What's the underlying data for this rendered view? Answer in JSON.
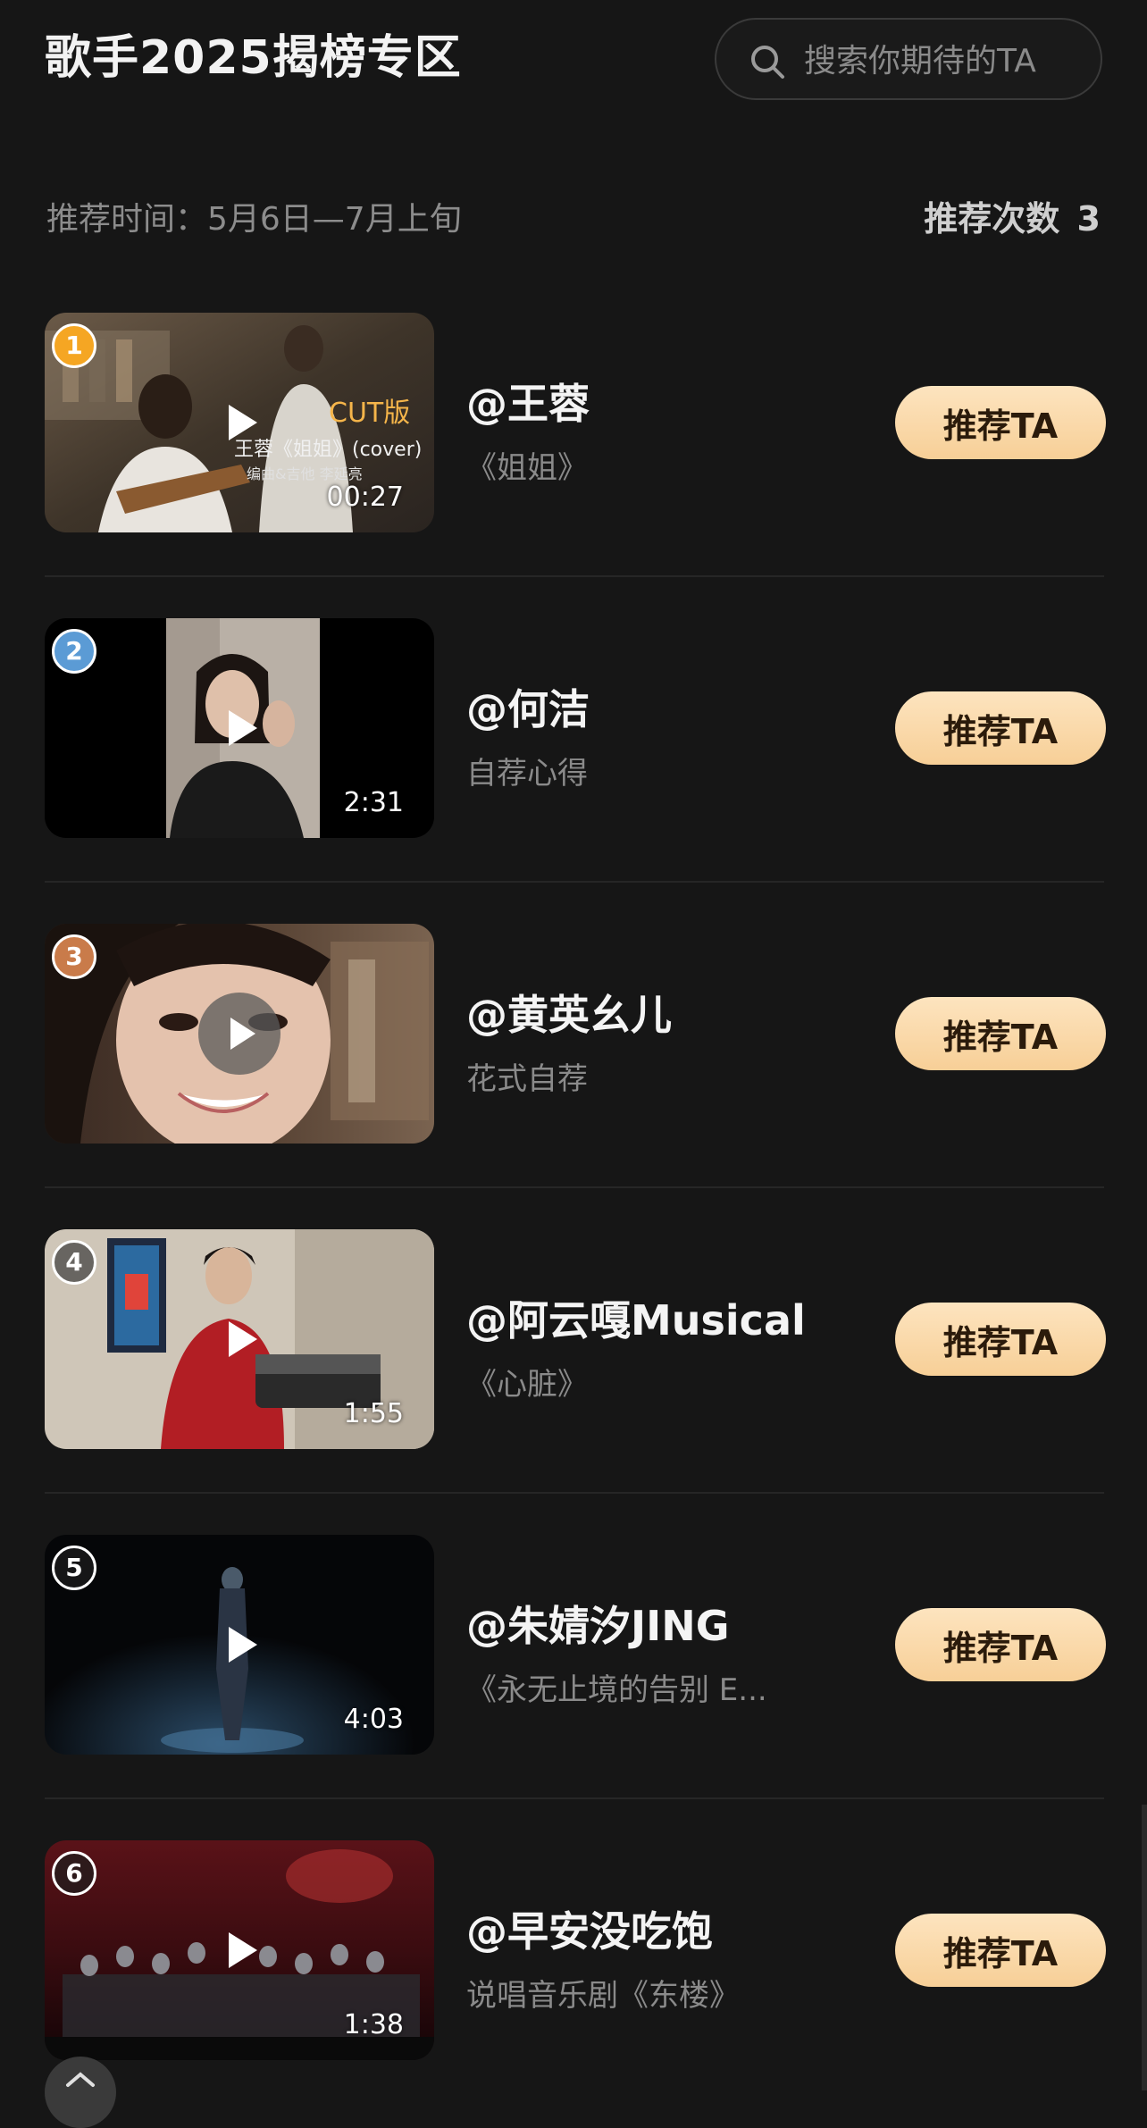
{
  "header": {
    "title": "歌手2025揭榜专区",
    "search_placeholder": "搜索你期待的TA"
  },
  "info": {
    "time_text": "推荐时间：5月6日—7月上旬",
    "count_label": "推荐次数",
    "count_value": "3"
  },
  "button_label": "推荐TA",
  "items": [
    {
      "rank": "1",
      "name": "@王蓉",
      "sub": "《姐姐》",
      "duration": "00:27",
      "rank_color": "#f5a623",
      "overlay": {
        "tag": "CUT版",
        "caption": "王蓉《姐姐》(cover)",
        "credits": "编曲&吉他 李延亮"
      }
    },
    {
      "rank": "2",
      "name": "@何洁",
      "sub": "自荐心得",
      "duration": "2:31",
      "rank_color": "#5b9bd5"
    },
    {
      "rank": "3",
      "name": "@黄英幺儿",
      "sub": "花式自荐",
      "duration": "",
      "rank_color": "#c97b4a"
    },
    {
      "rank": "4",
      "name": "@阿云嘎Musical",
      "sub": "《心脏》",
      "duration": "1:55",
      "rank_color": "rgba(60,60,60,0.7)"
    },
    {
      "rank": "5",
      "name": "@朱婧汐JING",
      "sub": "《永无止境的告别 E...",
      "duration": "4:03",
      "rank_color": "rgba(30,30,30,0.7)"
    },
    {
      "rank": "6",
      "name": "@早安没吃饱",
      "sub": "说唱音乐剧《东楼》",
      "duration": "1:38",
      "rank_color": "rgba(30,30,30,0.7)"
    }
  ],
  "icons": {
    "search": "search-icon",
    "play": "play-icon",
    "collapse": "chevron-up-icon"
  }
}
